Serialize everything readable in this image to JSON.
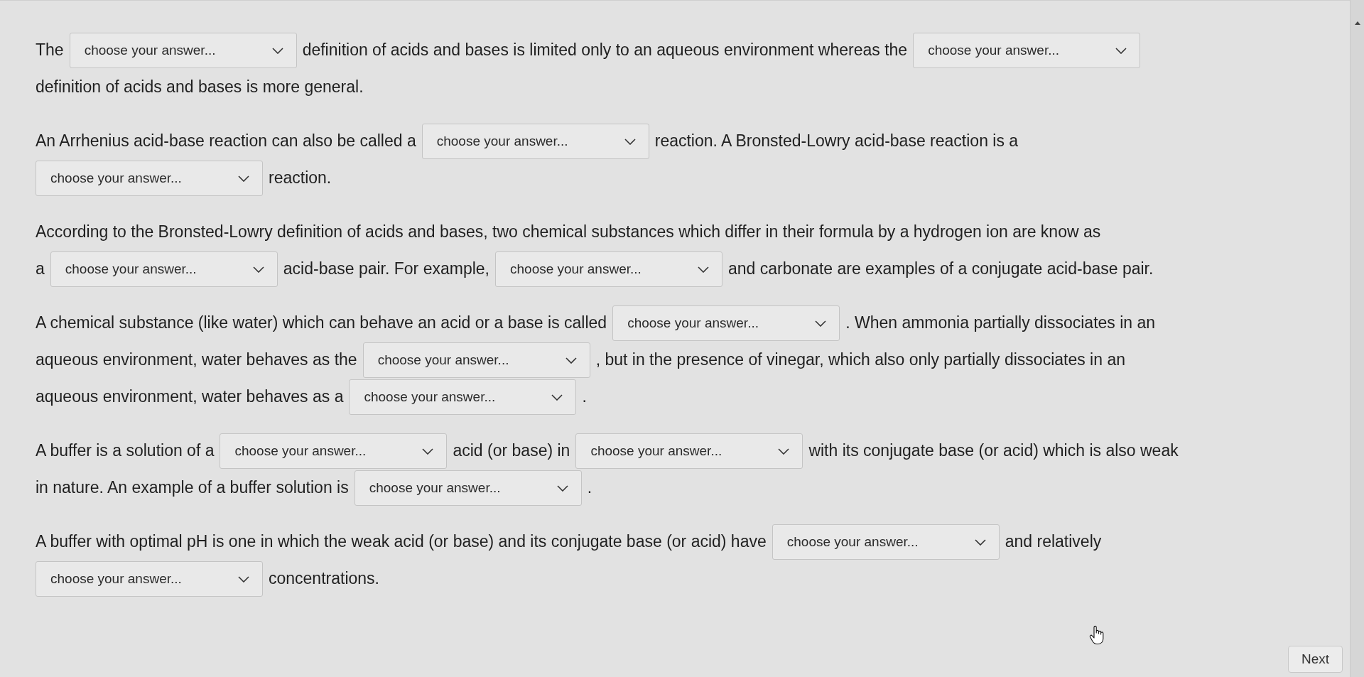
{
  "questions": [
    {
      "lines": [
        {
          "parts": [
            {
              "kind": "text",
              "text": "The"
            },
            {
              "kind": "select",
              "placeholder": "choose your answer..."
            },
            {
              "kind": "text",
              "text": "definition of acids and bases is limited only to an aqueous environment whereas the"
            },
            {
              "kind": "select",
              "placeholder": "choose your answer..."
            }
          ]
        },
        {
          "parts": [
            {
              "kind": "text",
              "text": "definition of acids and bases is more general."
            }
          ]
        }
      ]
    },
    {
      "lines": [
        {
          "parts": [
            {
              "kind": "text",
              "text": "An Arrhenius acid-base reaction can also be called a"
            },
            {
              "kind": "select",
              "placeholder": "choose your answer..."
            },
            {
              "kind": "text",
              "text": "reaction. A Bronsted-Lowry acid-base reaction is a"
            }
          ]
        },
        {
          "parts": [
            {
              "kind": "select",
              "placeholder": "choose your answer..."
            },
            {
              "kind": "text",
              "text": "reaction."
            }
          ]
        }
      ]
    },
    {
      "lines": [
        {
          "parts": [
            {
              "kind": "text",
              "text": "According to the Bronsted-Lowry definition of acids and bases, two chemical substances which differ in their formula by a hydrogen ion are know as"
            }
          ]
        },
        {
          "parts": [
            {
              "kind": "text",
              "text": "a"
            },
            {
              "kind": "select",
              "placeholder": "choose your answer..."
            },
            {
              "kind": "text",
              "text": "acid-base pair. For example,"
            },
            {
              "kind": "select",
              "placeholder": "choose your answer..."
            },
            {
              "kind": "text",
              "text": "and carbonate are examples of a conjugate acid-base pair."
            }
          ]
        }
      ]
    },
    {
      "lines": [
        {
          "parts": [
            {
              "kind": "text",
              "text": "A chemical substance (like water) which can behave an acid or a base is called"
            },
            {
              "kind": "select",
              "placeholder": "choose your answer..."
            },
            {
              "kind": "text",
              "text": ". When ammonia partially dissociates in an"
            }
          ]
        },
        {
          "parts": [
            {
              "kind": "text",
              "text": "aqueous environment, water behaves as the"
            },
            {
              "kind": "select",
              "placeholder": "choose your answer..."
            },
            {
              "kind": "text",
              "text": ", but in the presence of vinegar, which also only partially dissociates in an"
            }
          ]
        },
        {
          "parts": [
            {
              "kind": "text",
              "text": "aqueous environment, water behaves as a"
            },
            {
              "kind": "select",
              "placeholder": "choose your answer..."
            },
            {
              "kind": "text",
              "text": "."
            }
          ]
        }
      ]
    },
    {
      "lines": [
        {
          "parts": [
            {
              "kind": "text",
              "text": "A buffer is a solution of a"
            },
            {
              "kind": "select",
              "placeholder": "choose your answer..."
            },
            {
              "kind": "text",
              "text": "acid (or base) in"
            },
            {
              "kind": "select",
              "placeholder": "choose your answer..."
            },
            {
              "kind": "text",
              "text": "with its conjugate base (or acid) which is also weak"
            }
          ]
        },
        {
          "parts": [
            {
              "kind": "text",
              "text": "in nature. An example of a buffer solution is"
            },
            {
              "kind": "select",
              "placeholder": "choose your answer..."
            },
            {
              "kind": "text",
              "text": "."
            }
          ]
        }
      ]
    },
    {
      "lines": [
        {
          "parts": [
            {
              "kind": "text",
              "text": "A buffer with optimal pH is one in which the weak acid (or base) and its conjugate base (or acid) have"
            },
            {
              "kind": "select",
              "placeholder": "choose your answer..."
            },
            {
              "kind": "text",
              "text": "and relatively"
            }
          ]
        },
        {
          "parts": [
            {
              "kind": "select",
              "placeholder": "choose your answer..."
            },
            {
              "kind": "text",
              "text": "concentrations."
            }
          ]
        }
      ]
    }
  ],
  "next_button": {
    "label": "Next"
  }
}
